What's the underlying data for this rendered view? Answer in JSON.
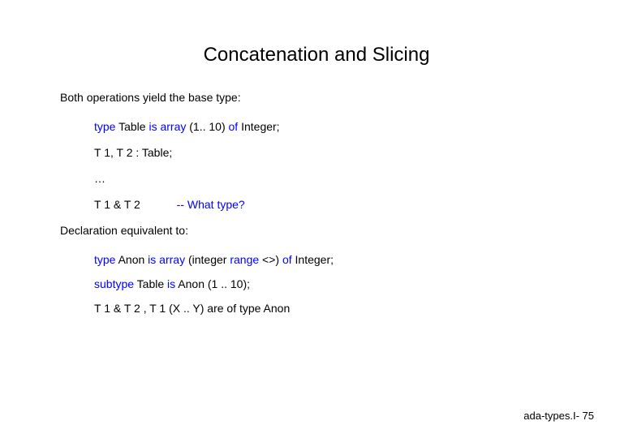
{
  "title": "Concatenation and Slicing",
  "intro": "Both operations yield the base type:",
  "code1": {
    "kw_type": "type",
    "table_name": " Table ",
    "kw_is_array": "is array",
    "range": " (1.. 10) ",
    "kw_of": "of",
    "intType": " Integer;"
  },
  "code2": "T 1, T 2 : Table;",
  "ellipsis": "…",
  "concat": {
    "expr": "T 1 & T 2",
    "comment": "-- What type?"
  },
  "decl_equiv": "Declaration equivalent to:",
  "anon1": {
    "kw_type": "type",
    "name": " Anon ",
    "kw_is_array": "is array",
    "range": " (integer ",
    "kw_range": "range",
    "diamond": " <>) ",
    "kw_of": "of",
    "intType": " Integer;"
  },
  "anon2": {
    "kw_subtype": "subtype",
    "name": " Table ",
    "kw_is": "is",
    "rest": " Anon (1 .. 10);"
  },
  "anon3": " T 1 & T 2 , T 1 (X .. Y) are of type Anon",
  "footer": "ada-types.I- 75"
}
